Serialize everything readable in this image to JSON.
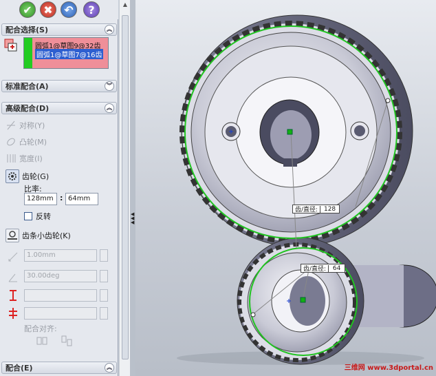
{
  "toolbar": {
    "ok": "✔",
    "cancel": "✖",
    "undo": "↶",
    "help": "?"
  },
  "mate_selections": {
    "header": "配合选择(S)",
    "items": [
      "圆弧1@草图9@32齿",
      "圆弧1@草图7@16齿"
    ]
  },
  "standard_mates": {
    "header": "标准配合(A)"
  },
  "advanced_mates": {
    "header": "高级配合(D)",
    "options": [
      {
        "label": "对称(Y)",
        "enabled": false,
        "icon": "symmetric-icon"
      },
      {
        "label": "凸轮(M)",
        "enabled": false,
        "icon": "cam-icon"
      },
      {
        "label": "宽度(I)",
        "enabled": false,
        "icon": "width-icon"
      },
      {
        "label": "齿轮(G)",
        "enabled": true,
        "icon": "gear-icon"
      }
    ],
    "ratio_label": "比率:",
    "ratio_a": "128mm",
    "ratio_sep": ":",
    "ratio_b": "64mm",
    "reverse_label": "反转",
    "rack_pinion_label": "齿条小齿轮(K)",
    "distance_value": "1.00mm",
    "angle_value": "30.00deg",
    "mate_alignment_label": "配合对齐:"
  },
  "mates": {
    "header": "配合(E)"
  },
  "viewport": {
    "dim_top": {
      "label": "齿/直径:",
      "value": "128"
    },
    "dim_bottom": {
      "label": "齿/直径:",
      "value": "64"
    },
    "watermark": "三维网 www.3dportal.cn"
  }
}
